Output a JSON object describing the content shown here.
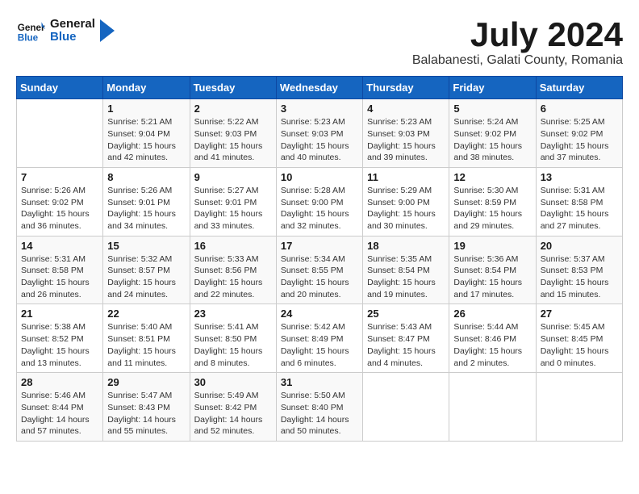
{
  "logo": {
    "name": "General",
    "name2": "Blue"
  },
  "title": "July 2024",
  "subtitle": "Balabanesti, Galati County, Romania",
  "days_header": [
    "Sunday",
    "Monday",
    "Tuesday",
    "Wednesday",
    "Thursday",
    "Friday",
    "Saturday"
  ],
  "weeks": [
    [
      {
        "day": "",
        "info": ""
      },
      {
        "day": "1",
        "info": "Sunrise: 5:21 AM\nSunset: 9:04 PM\nDaylight: 15 hours\nand 42 minutes."
      },
      {
        "day": "2",
        "info": "Sunrise: 5:22 AM\nSunset: 9:03 PM\nDaylight: 15 hours\nand 41 minutes."
      },
      {
        "day": "3",
        "info": "Sunrise: 5:23 AM\nSunset: 9:03 PM\nDaylight: 15 hours\nand 40 minutes."
      },
      {
        "day": "4",
        "info": "Sunrise: 5:23 AM\nSunset: 9:03 PM\nDaylight: 15 hours\nand 39 minutes."
      },
      {
        "day": "5",
        "info": "Sunrise: 5:24 AM\nSunset: 9:02 PM\nDaylight: 15 hours\nand 38 minutes."
      },
      {
        "day": "6",
        "info": "Sunrise: 5:25 AM\nSunset: 9:02 PM\nDaylight: 15 hours\nand 37 minutes."
      }
    ],
    [
      {
        "day": "7",
        "info": "Sunrise: 5:26 AM\nSunset: 9:02 PM\nDaylight: 15 hours\nand 36 minutes."
      },
      {
        "day": "8",
        "info": "Sunrise: 5:26 AM\nSunset: 9:01 PM\nDaylight: 15 hours\nand 34 minutes."
      },
      {
        "day": "9",
        "info": "Sunrise: 5:27 AM\nSunset: 9:01 PM\nDaylight: 15 hours\nand 33 minutes."
      },
      {
        "day": "10",
        "info": "Sunrise: 5:28 AM\nSunset: 9:00 PM\nDaylight: 15 hours\nand 32 minutes."
      },
      {
        "day": "11",
        "info": "Sunrise: 5:29 AM\nSunset: 9:00 PM\nDaylight: 15 hours\nand 30 minutes."
      },
      {
        "day": "12",
        "info": "Sunrise: 5:30 AM\nSunset: 8:59 PM\nDaylight: 15 hours\nand 29 minutes."
      },
      {
        "day": "13",
        "info": "Sunrise: 5:31 AM\nSunset: 8:58 PM\nDaylight: 15 hours\nand 27 minutes."
      }
    ],
    [
      {
        "day": "14",
        "info": "Sunrise: 5:31 AM\nSunset: 8:58 PM\nDaylight: 15 hours\nand 26 minutes."
      },
      {
        "day": "15",
        "info": "Sunrise: 5:32 AM\nSunset: 8:57 PM\nDaylight: 15 hours\nand 24 minutes."
      },
      {
        "day": "16",
        "info": "Sunrise: 5:33 AM\nSunset: 8:56 PM\nDaylight: 15 hours\nand 22 minutes."
      },
      {
        "day": "17",
        "info": "Sunrise: 5:34 AM\nSunset: 8:55 PM\nDaylight: 15 hours\nand 20 minutes."
      },
      {
        "day": "18",
        "info": "Sunrise: 5:35 AM\nSunset: 8:54 PM\nDaylight: 15 hours\nand 19 minutes."
      },
      {
        "day": "19",
        "info": "Sunrise: 5:36 AM\nSunset: 8:54 PM\nDaylight: 15 hours\nand 17 minutes."
      },
      {
        "day": "20",
        "info": "Sunrise: 5:37 AM\nSunset: 8:53 PM\nDaylight: 15 hours\nand 15 minutes."
      }
    ],
    [
      {
        "day": "21",
        "info": "Sunrise: 5:38 AM\nSunset: 8:52 PM\nDaylight: 15 hours\nand 13 minutes."
      },
      {
        "day": "22",
        "info": "Sunrise: 5:40 AM\nSunset: 8:51 PM\nDaylight: 15 hours\nand 11 minutes."
      },
      {
        "day": "23",
        "info": "Sunrise: 5:41 AM\nSunset: 8:50 PM\nDaylight: 15 hours\nand 8 minutes."
      },
      {
        "day": "24",
        "info": "Sunrise: 5:42 AM\nSunset: 8:49 PM\nDaylight: 15 hours\nand 6 minutes."
      },
      {
        "day": "25",
        "info": "Sunrise: 5:43 AM\nSunset: 8:47 PM\nDaylight: 15 hours\nand 4 minutes."
      },
      {
        "day": "26",
        "info": "Sunrise: 5:44 AM\nSunset: 8:46 PM\nDaylight: 15 hours\nand 2 minutes."
      },
      {
        "day": "27",
        "info": "Sunrise: 5:45 AM\nSunset: 8:45 PM\nDaylight: 15 hours\nand 0 minutes."
      }
    ],
    [
      {
        "day": "28",
        "info": "Sunrise: 5:46 AM\nSunset: 8:44 PM\nDaylight: 14 hours\nand 57 minutes."
      },
      {
        "day": "29",
        "info": "Sunrise: 5:47 AM\nSunset: 8:43 PM\nDaylight: 14 hours\nand 55 minutes."
      },
      {
        "day": "30",
        "info": "Sunrise: 5:49 AM\nSunset: 8:42 PM\nDaylight: 14 hours\nand 52 minutes."
      },
      {
        "day": "31",
        "info": "Sunrise: 5:50 AM\nSunset: 8:40 PM\nDaylight: 14 hours\nand 50 minutes."
      },
      {
        "day": "",
        "info": ""
      },
      {
        "day": "",
        "info": ""
      },
      {
        "day": "",
        "info": ""
      }
    ]
  ]
}
